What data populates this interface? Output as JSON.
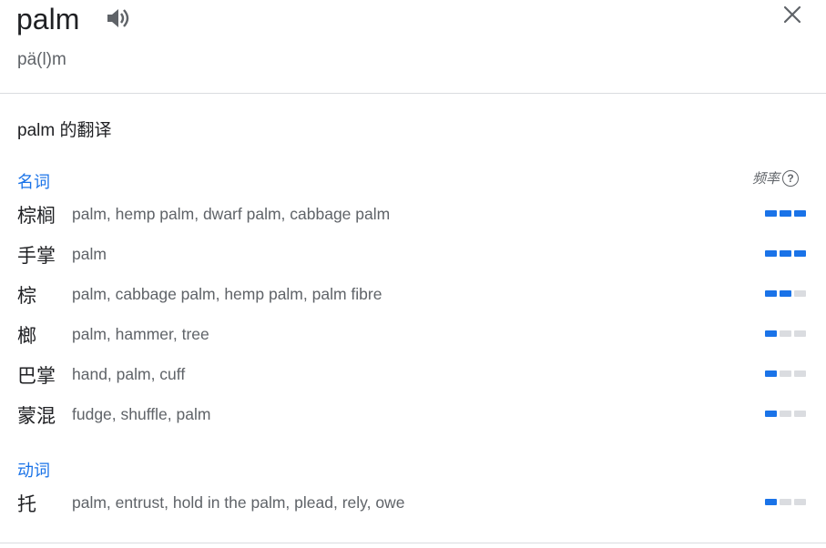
{
  "entry": {
    "word": "palm",
    "phonetic": "pä(l)m"
  },
  "translations": {
    "title": "palm 的翻译",
    "frequency_label": "频率",
    "frequency_help": "?",
    "colors": {
      "accent": "#1a73e8",
      "inactive": "#dadce0",
      "muted": "#5f6368"
    },
    "groups": [
      {
        "pos": "名词",
        "rows": [
          {
            "term": "棕榈",
            "meanings": "palm, hemp palm, dwarf palm, cabbage palm",
            "frequency": 3
          },
          {
            "term": "手掌",
            "meanings": "palm",
            "frequency": 3
          },
          {
            "term": "棕",
            "meanings": "palm, cabbage palm, hemp palm, palm fibre",
            "frequency": 2
          },
          {
            "term": "榔",
            "meanings": "palm, hammer, tree",
            "frequency": 1
          },
          {
            "term": "巴掌",
            "meanings": "hand, palm, cuff",
            "frequency": 1
          },
          {
            "term": "蒙混",
            "meanings": "fudge, shuffle, palm",
            "frequency": 1
          }
        ]
      },
      {
        "pos": "动词",
        "rows": [
          {
            "term": "托",
            "meanings": "palm, entrust, hold in the palm, plead, rely, owe",
            "frequency": 1
          }
        ]
      }
    ]
  },
  "icons": {
    "speaker": "speaker-icon",
    "close": "close-icon",
    "help": "help-circle-icon"
  }
}
